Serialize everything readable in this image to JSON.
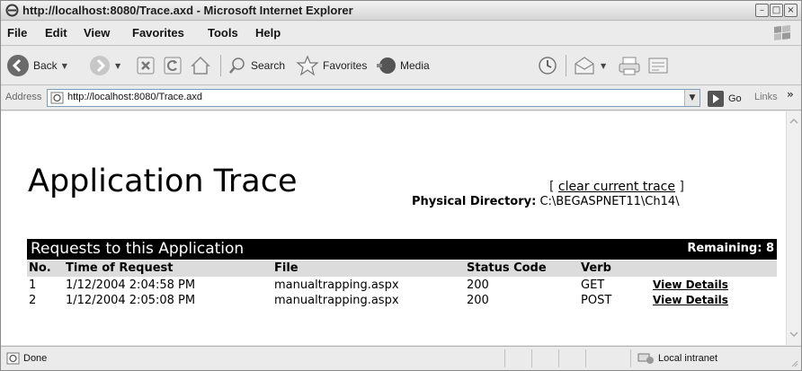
{
  "window": {
    "title": "http://localhost:8080/Trace.axd - Microsoft Internet Explorer"
  },
  "menu": [
    "File",
    "Edit",
    "View",
    "Favorites",
    "Tools",
    "Help"
  ],
  "toolbar": {
    "back_label": "Back",
    "search_label": "Search",
    "favorites_label": "Favorites",
    "media_label": "Media"
  },
  "address": {
    "label": "Address",
    "url": "http://localhost:8080/Trace.axd",
    "go_label": "Go",
    "links_label": "Links"
  },
  "page": {
    "title": "Application Trace",
    "clear_prefix": "[ ",
    "clear_link": "clear current trace",
    "clear_suffix": " ]",
    "physical_label": "Physical Directory:",
    "physical_value": "C:\\BEGASPNET11\\Ch14\\",
    "requests_title": "Requests to this Application",
    "remaining": "Remaining: 8",
    "columns": [
      "No.",
      "Time of Request",
      "File",
      "Status Code",
      "Verb",
      ""
    ],
    "rows": [
      [
        "1",
        "1/12/2004 2:04:58 PM",
        "manualtrapping.aspx",
        "200",
        "GET",
        "View Details"
      ],
      [
        "2",
        "1/12/2004 2:05:08 PM",
        "manualtrapping.aspx",
        "200",
        "POST",
        "View Details"
      ]
    ]
  },
  "status": {
    "text": "Done",
    "zone": "Local intranet"
  },
  "icons": {
    "back": "back-arrow-icon",
    "forward": "forward-arrow-icon",
    "stop": "stop-icon",
    "refresh": "refresh-icon",
    "home": "home-icon",
    "search": "search-icon",
    "favorites": "favorites-star-icon",
    "media": "media-icon",
    "history": "history-icon",
    "mail": "mail-icon",
    "print": "print-icon",
    "edit": "edit-icon"
  }
}
